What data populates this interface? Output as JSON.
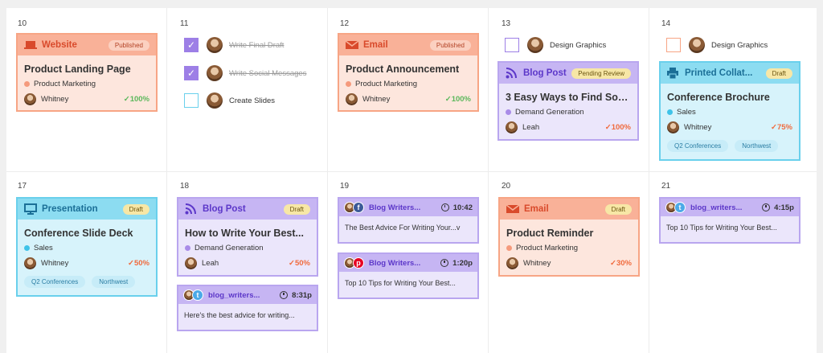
{
  "colors": {
    "website": "#f9b198",
    "blog": "#c6b5f3",
    "printed": "#8cdcf1"
  },
  "days": [
    "10",
    "11",
    "12",
    "13",
    "14",
    "17",
    "18",
    "19",
    "20",
    "21"
  ],
  "cards": {
    "website": {
      "type": "Website",
      "status": "Published",
      "title": "Product Landing Page",
      "category": "Product Marketing",
      "owner": "Whitney",
      "progress": "100%",
      "icon": "laptop-icon"
    },
    "email1": {
      "type": "Email",
      "status": "Published",
      "title": "Product Announcement",
      "category": "Product Marketing",
      "owner": "Whitney",
      "progress": "100%",
      "icon": "envelope-icon"
    },
    "blog13": {
      "type": "Blog Post",
      "status": "Pending Review",
      "title": "3 Easy Ways to Find Social...",
      "category": "Demand Generation",
      "owner": "Leah",
      "progress": "100%",
      "icon": "rss-icon"
    },
    "printed": {
      "type": "Printed Collat...",
      "status": "Draft",
      "title": "Conference Brochure",
      "category": "Sales",
      "owner": "Whitney",
      "progress": "75%",
      "tags": [
        "Q2 Conferences",
        "Northwest"
      ],
      "icon": "printer-icon"
    },
    "presentation": {
      "type": "Presentation",
      "status": "Draft",
      "title": "Conference Slide Deck",
      "category": "Sales",
      "owner": "Whitney",
      "progress": "50%",
      "tags": [
        "Q2 Conferences",
        "Northwest"
      ],
      "icon": "presentation-icon"
    },
    "blog18": {
      "type": "Blog Post",
      "status": "Draft",
      "title": "How to Write Your Best...",
      "category": "Demand Generation",
      "owner": "Leah",
      "progress": "50%",
      "icon": "rss-icon"
    },
    "email2": {
      "type": "Email",
      "status": "Draft",
      "title": "Product Reminder",
      "category": "Product Marketing",
      "owner": "Whitney",
      "progress": "30%",
      "icon": "envelope-icon"
    }
  },
  "tasks": {
    "t1": {
      "label": "Write Final Draft",
      "done": true
    },
    "t2": {
      "label": "Write Social Messages",
      "done": true
    },
    "t3": {
      "label": "Create Slides",
      "done": false
    },
    "t4": {
      "label": "Design Graphics",
      "done": false
    },
    "t5": {
      "label": "Design Graphics",
      "done": false
    }
  },
  "social": {
    "s1": {
      "network": "facebook",
      "name": "Blog Writers...",
      "time": "10:42",
      "text": "The Best Advice For Writing Your...v"
    },
    "s2": {
      "network": "pinterest",
      "name": "Blog Writers...",
      "time": "1:20p",
      "text": "Top 10 Tips for Writing Your Best..."
    },
    "s3": {
      "network": "twitter",
      "name": "blog_writers...",
      "time": "8:31p",
      "text": "Here's the best advice for writing..."
    },
    "s4": {
      "network": "twitter",
      "name": "blog_writers...",
      "time": "4:15p",
      "text": "Top 10 Tips for Writing Your Best..."
    }
  }
}
